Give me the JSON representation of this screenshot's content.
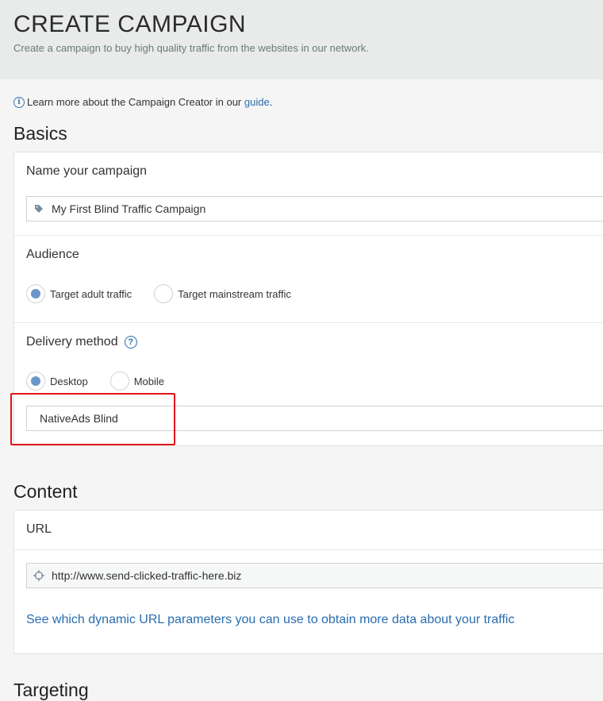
{
  "header": {
    "title": "CREATE CAMPAIGN",
    "subtitle": "Create a campaign to buy high quality traffic from the websites in our network."
  },
  "info": {
    "text": "Learn more about the Campaign Creator in our ",
    "link": "guide",
    "suffix": "."
  },
  "basics": {
    "title": "Basics",
    "name": {
      "label": "Name your campaign",
      "value": "My First Blind Traffic Campaign"
    },
    "audience": {
      "label": "Audience",
      "options": [
        "Target adult traffic",
        "Target mainstream traffic"
      ],
      "selected": "Target adult traffic"
    },
    "delivery": {
      "label": "Delivery method",
      "options": [
        "Desktop",
        "Mobile"
      ],
      "selected": "Desktop",
      "product_value": "NativeAds Blind"
    }
  },
  "content": {
    "title": "Content",
    "url": {
      "label": "URL",
      "value": "http://www.send-clicked-traffic-here.biz"
    },
    "params_link": "See which dynamic URL parameters you can use to obtain more data about your traffic"
  },
  "targeting": {
    "title": "Targeting"
  },
  "colors": {
    "link": "#2a6db0",
    "radio_selected": "#6b97c8",
    "highlight": "#e0141b"
  }
}
